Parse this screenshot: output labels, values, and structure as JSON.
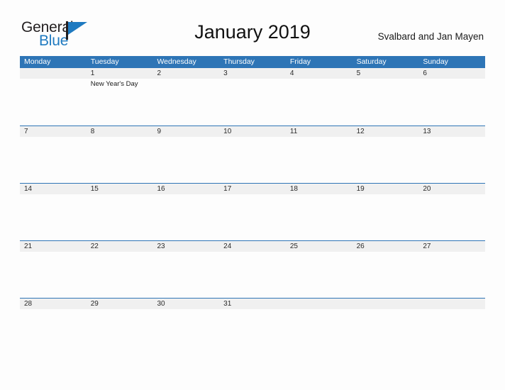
{
  "brand": {
    "word_one": "General",
    "word_two": "Blue",
    "mark_icon": "blue-triangle-flag-icon",
    "accent_color": "#1f7ac0"
  },
  "header": {
    "month_title": "January 2019",
    "locale_title": "Svalbard and Jan Mayen"
  },
  "theme": {
    "header_band_color": "#2e75b6",
    "row_separator_color": "#2e75b6",
    "date_band_color": "#f0f0f0",
    "page_background": "#fdfdfd"
  },
  "calendar": {
    "day_headers": [
      "Monday",
      "Tuesday",
      "Wednesday",
      "Thursday",
      "Friday",
      "Saturday",
      "Sunday"
    ],
    "weeks": [
      {
        "days": [
          {
            "date": "",
            "event": ""
          },
          {
            "date": "1",
            "event": "New Year's Day"
          },
          {
            "date": "2",
            "event": ""
          },
          {
            "date": "3",
            "event": ""
          },
          {
            "date": "4",
            "event": ""
          },
          {
            "date": "5",
            "event": ""
          },
          {
            "date": "6",
            "event": ""
          }
        ]
      },
      {
        "days": [
          {
            "date": "7",
            "event": ""
          },
          {
            "date": "8",
            "event": ""
          },
          {
            "date": "9",
            "event": ""
          },
          {
            "date": "10",
            "event": ""
          },
          {
            "date": "11",
            "event": ""
          },
          {
            "date": "12",
            "event": ""
          },
          {
            "date": "13",
            "event": ""
          }
        ]
      },
      {
        "days": [
          {
            "date": "14",
            "event": ""
          },
          {
            "date": "15",
            "event": ""
          },
          {
            "date": "16",
            "event": ""
          },
          {
            "date": "17",
            "event": ""
          },
          {
            "date": "18",
            "event": ""
          },
          {
            "date": "19",
            "event": ""
          },
          {
            "date": "20",
            "event": ""
          }
        ]
      },
      {
        "days": [
          {
            "date": "21",
            "event": ""
          },
          {
            "date": "22",
            "event": ""
          },
          {
            "date": "23",
            "event": ""
          },
          {
            "date": "24",
            "event": ""
          },
          {
            "date": "25",
            "event": ""
          },
          {
            "date": "26",
            "event": ""
          },
          {
            "date": "27",
            "event": ""
          }
        ]
      },
      {
        "days": [
          {
            "date": "28",
            "event": ""
          },
          {
            "date": "29",
            "event": ""
          },
          {
            "date": "30",
            "event": ""
          },
          {
            "date": "31",
            "event": ""
          },
          {
            "date": "",
            "event": ""
          },
          {
            "date": "",
            "event": ""
          },
          {
            "date": "",
            "event": ""
          }
        ]
      }
    ]
  }
}
